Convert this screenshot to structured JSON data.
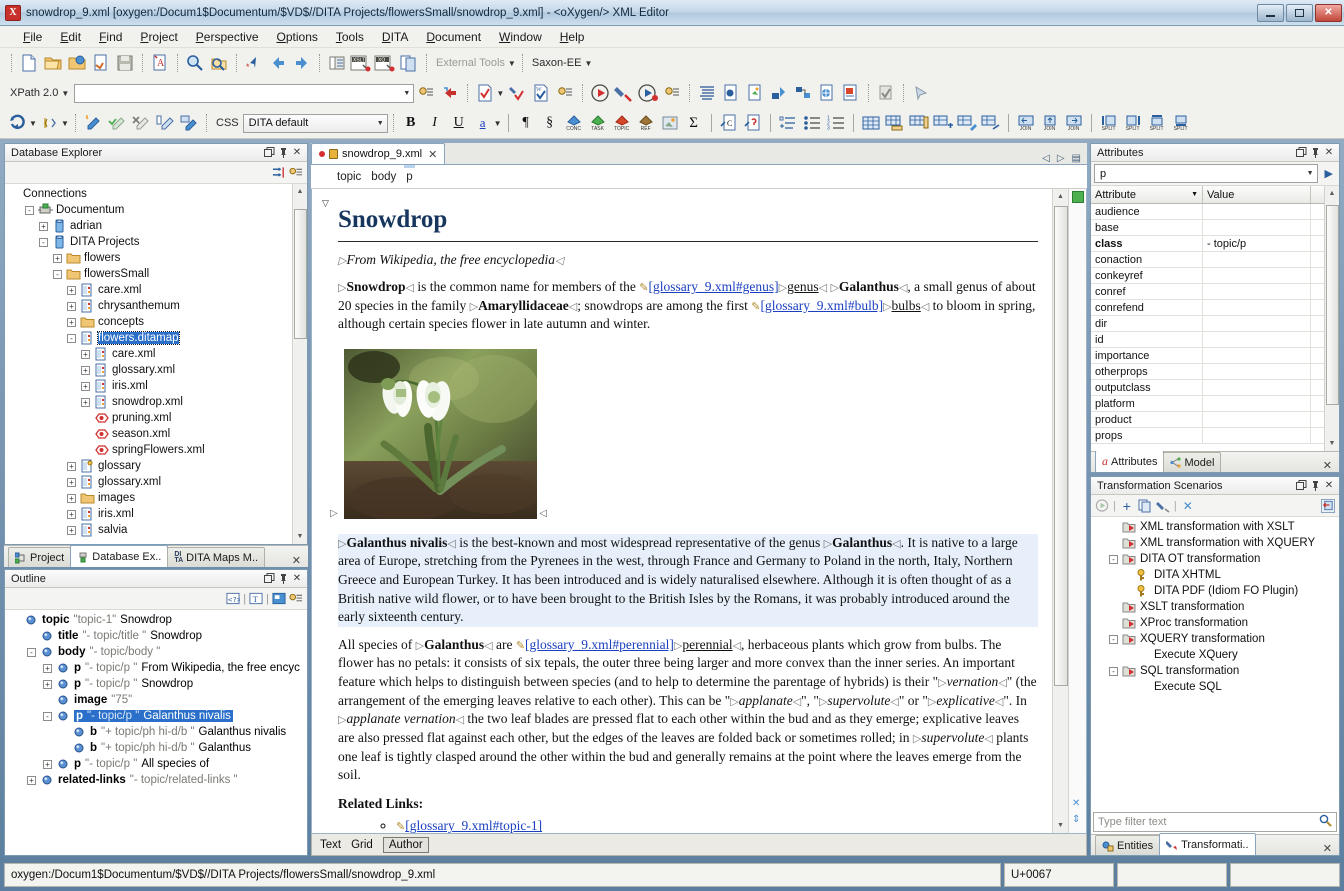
{
  "window": {
    "title": "snowdrop_9.xml [oxygen:/Docum1$Documentum/$VD$//DITA Projects/flowersSmall/snowdrop_9.xml] - <oXygen/> XML Editor",
    "app_icon": "X",
    "minimize_label": "Minimize",
    "maximize_label": "Maximize",
    "close_label": "Close"
  },
  "menubar": {
    "items": [
      "File",
      "Edit",
      "Find",
      "Project",
      "Perspective",
      "Options",
      "Tools",
      "DITA",
      "Document",
      "Window",
      "Help"
    ]
  },
  "toolbar": {
    "external_tools_label": "External Tools",
    "transformer_label": "Saxon-EE",
    "xpath_label": "XPath 2.0",
    "xpath_value": "",
    "css_label": "CSS",
    "css_value": "DITA default",
    "format_buttons": [
      "B",
      "I",
      "U",
      "a"
    ],
    "dita_buttons": [
      "CONC",
      "TASK",
      "TOPIC",
      "REF"
    ],
    "table_buttons": [
      "JOIN",
      "JOIN",
      "JOIN",
      "SPLIT",
      "SPLIT",
      "SPLIT",
      "SPLIT"
    ],
    "sigma": "Σ",
    "pilcrow": "¶",
    "section": "§"
  },
  "database_explorer": {
    "title": "Database Explorer",
    "root_label": "Connections",
    "nodes": [
      {
        "label": "Connections",
        "depth": 0,
        "icon": "none",
        "expander": ""
      },
      {
        "label": "Documentum",
        "depth": 1,
        "icon": "connection",
        "expander": "-"
      },
      {
        "label": "adrian",
        "depth": 2,
        "icon": "db",
        "expander": "+"
      },
      {
        "label": "DITA Projects",
        "depth": 2,
        "icon": "db",
        "expander": "-"
      },
      {
        "label": "flowers",
        "depth": 3,
        "icon": "folder",
        "expander": "+"
      },
      {
        "label": "flowersSmall",
        "depth": 3,
        "icon": "folder",
        "expander": "-"
      },
      {
        "label": "care.xml",
        "depth": 4,
        "icon": "xml",
        "expander": "+"
      },
      {
        "label": "chrysanthemum",
        "depth": 4,
        "icon": "xml",
        "expander": "+"
      },
      {
        "label": "concepts",
        "depth": 4,
        "icon": "folder",
        "expander": "+"
      },
      {
        "label": "flowers.ditamap",
        "depth": 4,
        "icon": "xml",
        "expander": "-",
        "selected": true
      },
      {
        "label": "care.xml",
        "depth": 5,
        "icon": "xml",
        "expander": "+"
      },
      {
        "label": "glossary.xml",
        "depth": 5,
        "icon": "xml",
        "expander": "+"
      },
      {
        "label": "iris.xml",
        "depth": 5,
        "icon": "xml",
        "expander": "+"
      },
      {
        "label": "snowdrop.xml",
        "depth": 5,
        "icon": "xml",
        "expander": "+"
      },
      {
        "label": "pruning.xml",
        "depth": 5,
        "icon": "entity",
        "expander": ""
      },
      {
        "label": "season.xml",
        "depth": 5,
        "icon": "entity",
        "expander": ""
      },
      {
        "label": "springFlowers.xml",
        "depth": 5,
        "icon": "entity",
        "expander": ""
      },
      {
        "label": "glossary",
        "depth": 4,
        "icon": "xmlkey",
        "expander": "+"
      },
      {
        "label": "glossary.xml",
        "depth": 4,
        "icon": "xml",
        "expander": "+"
      },
      {
        "label": "images",
        "depth": 4,
        "icon": "folder",
        "expander": "+"
      },
      {
        "label": "iris.xml",
        "depth": 4,
        "icon": "xml",
        "expander": "+"
      },
      {
        "label": "salvia",
        "depth": 4,
        "icon": "xml",
        "expander": "+"
      }
    ]
  },
  "left_view_tabs": {
    "tabs": [
      {
        "label": "Project",
        "icon": "project-icon",
        "active": false
      },
      {
        "label": "Database Ex..",
        "icon": "database-icon",
        "active": true
      },
      {
        "label": "DITA Maps M..",
        "icon": "ditamaps-icon",
        "active": false
      }
    ],
    "close_label": "✕"
  },
  "outline": {
    "title": "Outline",
    "nodes": [
      {
        "name": "topic",
        "meta": "\"topic-1\"",
        "text": "Snowdrop",
        "depth": 0,
        "expander": ""
      },
      {
        "name": "title",
        "meta": "\"- topic/title \"",
        "text": "Snowdrop",
        "depth": 1,
        "expander": ""
      },
      {
        "name": "body",
        "meta": "\"- topic/body \"",
        "text": "",
        "depth": 1,
        "expander": "-"
      },
      {
        "name": "p",
        "meta": "\"- topic/p \"",
        "text": "From Wikipedia, the free encyc",
        "depth": 2,
        "expander": "+"
      },
      {
        "name": "p",
        "meta": "\"- topic/p \"",
        "text": "Snowdrop",
        "depth": 2,
        "expander": "+"
      },
      {
        "name": "image",
        "meta": "\"75\"",
        "text": "",
        "depth": 2,
        "expander": ""
      },
      {
        "name": "p",
        "meta": "\"- topic/p \"",
        "text": "Galanthus nivalis",
        "depth": 2,
        "expander": "-",
        "selected": true
      },
      {
        "name": "b",
        "meta": "\"+ topic/ph hi-d/b \"",
        "text": "Galanthus nivalis",
        "depth": 3,
        "expander": ""
      },
      {
        "name": "b",
        "meta": "\"+ topic/ph hi-d/b \"",
        "text": "Galanthus",
        "depth": 3,
        "expander": ""
      },
      {
        "name": "p",
        "meta": "\"- topic/p \"",
        "text": "All species of",
        "depth": 2,
        "expander": "+"
      },
      {
        "name": "related-links",
        "meta": "\"- topic/related-links \"",
        "text": "",
        "depth": 1,
        "expander": "+"
      }
    ]
  },
  "editor": {
    "tab_label": "snowdrop_9.xml",
    "tab_close": "✕",
    "breadcrumb": [
      "topic",
      "body",
      "p"
    ],
    "mode_tabs": [
      "Text",
      "Grid",
      "Author"
    ],
    "active_mode": "Author",
    "document": {
      "title": "Snowdrop",
      "subtitle": "From Wikipedia, the free encyclopedia",
      "p1_bold": "Snowdrop",
      "p1_a": " is the common name for members of the ",
      "p1_link1": "[glossary_9.xml#genus]",
      "p1_link1_text": "genus",
      "p1_b": " ",
      "p1_bold2": "Galanthus",
      "p1_c": ", a small genus of about 20 species in the family ",
      "p1_bold3": "Amaryllidaceae",
      "p1_d": "; snowdrops are among the first ",
      "p1_link2": "[glossary_9.xml#bulb]",
      "p1_link2_text": "bulbs",
      "p1_e": " to bloom in spring, although certain species flower in late autumn and winter.",
      "image_alt": "Snowdrop flower photograph",
      "p2_bold": "Galanthus nivalis",
      "p2_a": " is the best-known and most widespread representative of the genus ",
      "p2_bold2": "Galanthus",
      "p2_b": ". It is native to a large area of Europe, stretching from the Pyrenees in the west, through France and Germany to Poland in the north, Italy, Northern Greece and European Turkey. It has been introduced and is widely naturalised elsewhere. Although it is often thought of as a British native wild flower, or to have been brought to the British Isles by the Romans, it was probably introduced around the early sixteenth century.",
      "p3_a": "All species of ",
      "p3_bold": "Galanthus",
      "p3_b": " are ",
      "p3_link": "[glossary_9.xml#perennial]",
      "p3_link_text": "perennial",
      "p3_c": ", herbaceous plants which grow from bulbs. The flower has no petals: it consists of six tepals, the outer three being larger and more convex than the inner series. An important feature which helps to distinguish between species (and to help to determine the parentage of hybrids) is their \"",
      "p3_i1": "vernation",
      "p3_d": "\" (the arrangement of the emerging leaves relative to each other). This can be \"",
      "p3_i2": "applanate",
      "p3_e": "\", \"",
      "p3_i3": "supervolute",
      "p3_f": "\" or \"",
      "p3_i4": "explicative",
      "p3_g": "\". In ",
      "p3_i5": "applanate vernation",
      "p3_h": " the two leaf blades are pressed flat to each other within the bud and as they emerge; explicative leaves are also pressed flat against each other, but the edges of the leaves are folded back or sometimes rolled; in ",
      "p3_i6": "supervolute",
      "p3_i": " plants one leaf is tightly clasped around the other within the bud and generally remains at the point where the leaves emerge from the soil.",
      "related_links_title": "Related Links:",
      "related_link": "[glossary_9.xml#topic-1]"
    }
  },
  "attributes": {
    "title": "Attributes",
    "element_value": "p",
    "col_attribute": "Attribute",
    "col_value": "Value",
    "rows": [
      {
        "name": "audience",
        "value": ""
      },
      {
        "name": "base",
        "value": ""
      },
      {
        "name": "class",
        "value": "- topic/p",
        "bold": true
      },
      {
        "name": "conaction",
        "value": ""
      },
      {
        "name": "conkeyref",
        "value": ""
      },
      {
        "name": "conref",
        "value": ""
      },
      {
        "name": "conrefend",
        "value": ""
      },
      {
        "name": "dir",
        "value": ""
      },
      {
        "name": "id",
        "value": ""
      },
      {
        "name": "importance",
        "value": ""
      },
      {
        "name": "otherprops",
        "value": ""
      },
      {
        "name": "outputclass",
        "value": ""
      },
      {
        "name": "platform",
        "value": ""
      },
      {
        "name": "product",
        "value": ""
      },
      {
        "name": "props",
        "value": ""
      }
    ],
    "tabs": [
      {
        "label": "Attributes",
        "icon": "a-icon",
        "active": true
      },
      {
        "label": "Model",
        "icon": "model-icon",
        "active": false
      }
    ],
    "close_label": "✕"
  },
  "transformation_scenarios": {
    "title": "Transformation Scenarios",
    "nodes": [
      {
        "label": "XML transformation with XSLT",
        "depth": 1,
        "icon": "scenario",
        "expander": ""
      },
      {
        "label": "XML transformation with XQUERY",
        "depth": 1,
        "icon": "scenario",
        "expander": ""
      },
      {
        "label": "DITA OT transformation",
        "depth": 1,
        "icon": "scenario",
        "expander": "-"
      },
      {
        "label": "DITA XHTML",
        "depth": 2,
        "icon": "key",
        "expander": ""
      },
      {
        "label": "DITA PDF (Idiom FO Plugin)",
        "depth": 2,
        "icon": "key",
        "expander": ""
      },
      {
        "label": "XSLT transformation",
        "depth": 1,
        "icon": "scenario",
        "expander": ""
      },
      {
        "label": "XProc transformation",
        "depth": 1,
        "icon": "scenario",
        "expander": ""
      },
      {
        "label": "XQUERY transformation",
        "depth": 1,
        "icon": "scenario",
        "expander": "-"
      },
      {
        "label": "Execute XQuery",
        "depth": 2,
        "icon": "none",
        "expander": ""
      },
      {
        "label": "SQL transformation",
        "depth": 1,
        "icon": "scenario",
        "expander": "-"
      },
      {
        "label": "Execute SQL",
        "depth": 2,
        "icon": "none",
        "expander": ""
      }
    ],
    "filter_placeholder": "Type filter text",
    "tabs": [
      {
        "label": "Entities",
        "icon": "entities-icon",
        "active": false
      },
      {
        "label": "Transformati..",
        "icon": "transform-icon",
        "active": true
      }
    ],
    "close_label": "✕"
  },
  "statusbar": {
    "path": "oxygen:/Docum1$Documentum/$VD$//DITA Projects/flowersSmall/snowdrop_9.xml",
    "unicode": "U+0067",
    "cell3": "",
    "cell4": ""
  },
  "colors": {
    "accent_blue": "#2a6fc9",
    "title_blue": "#17365d",
    "link_blue": "#1a3fbf",
    "selection": "#e6effa",
    "panel_border": "#7d9ab3"
  }
}
